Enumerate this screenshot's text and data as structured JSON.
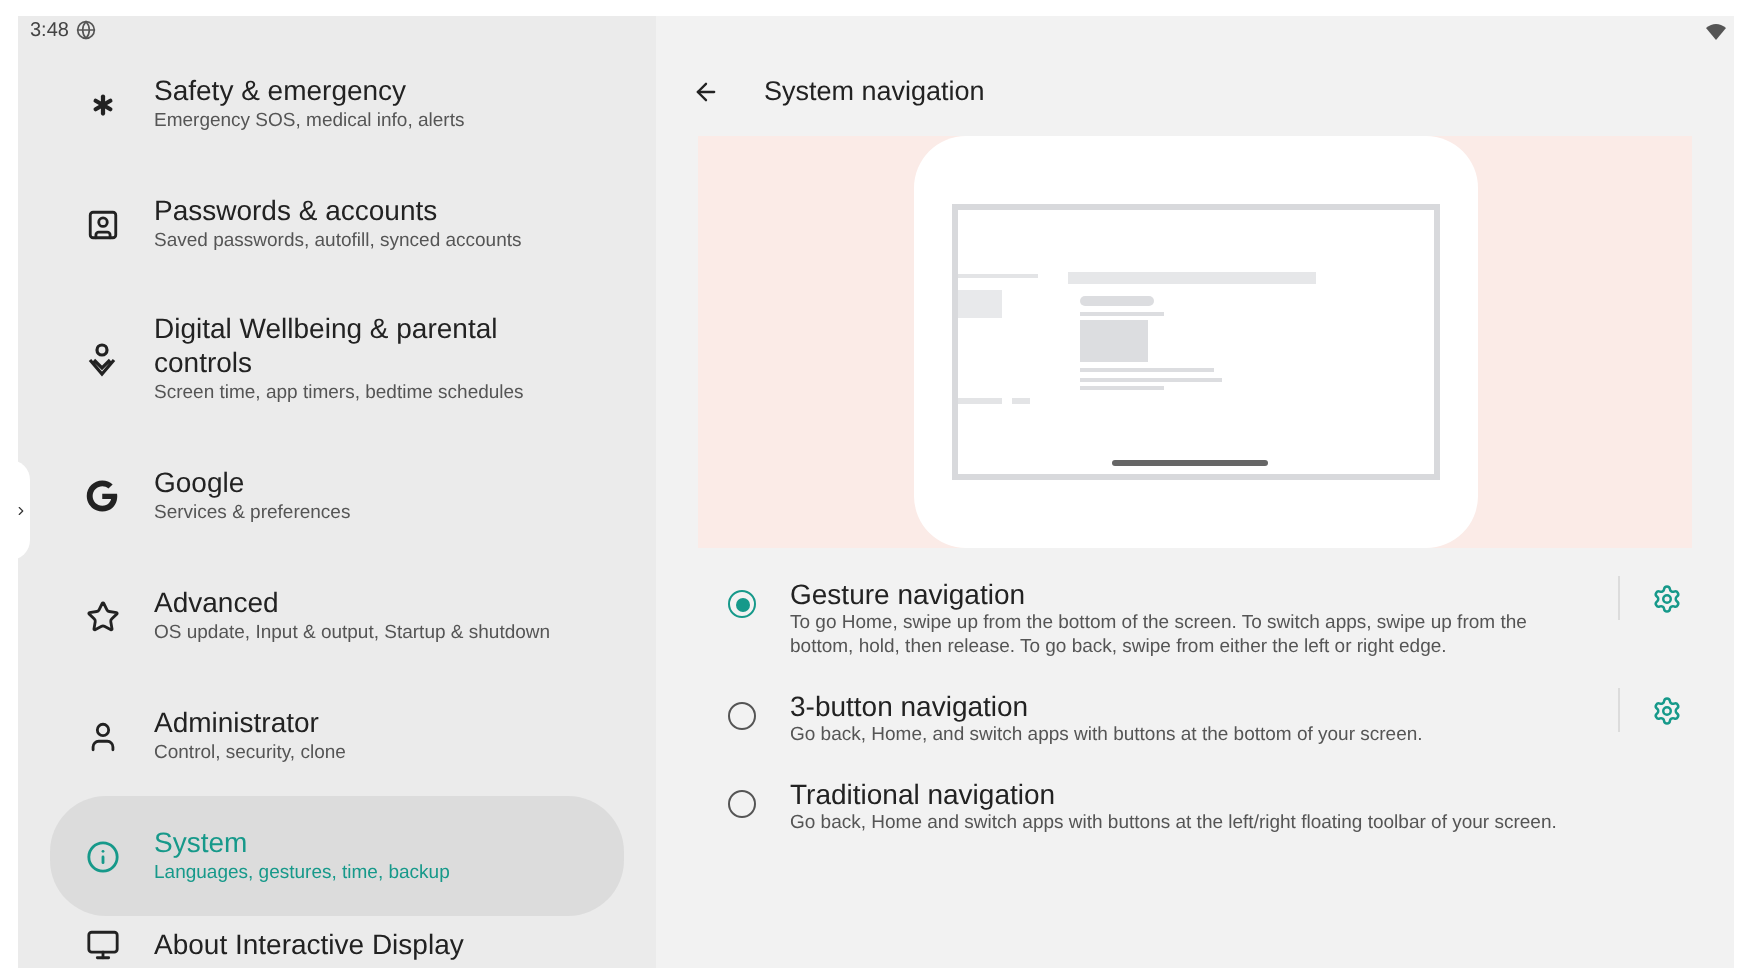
{
  "status_bar": {
    "time": "3:48"
  },
  "sidebar": {
    "items": [
      {
        "title": "Safety & emergency",
        "subtitle": "Emergency SOS, medical info, alerts",
        "selected": false
      },
      {
        "title": "Passwords & accounts",
        "subtitle": "Saved passwords, autofill, synced accounts",
        "selected": false
      },
      {
        "title": "Digital Wellbeing & parental controls",
        "subtitle": "Screen time, app timers, bedtime schedules",
        "selected": false
      },
      {
        "title": "Google",
        "subtitle": "Services & preferences",
        "selected": false
      },
      {
        "title": "Advanced",
        "subtitle": "OS update, Input & output, Startup & shutdown",
        "selected": false
      },
      {
        "title": "Administrator",
        "subtitle": "Control, security, clone",
        "selected": false
      },
      {
        "title": "System",
        "subtitle": "Languages, gestures, time, backup",
        "selected": true
      },
      {
        "title": "About Interactive Display",
        "selected": false
      }
    ]
  },
  "page": {
    "title": "System navigation",
    "options": [
      {
        "title": "Gesture navigation",
        "description": "To go Home, swipe up from the bottom of the screen. To switch apps, swipe up from the bottom, hold, then release. To go back, swipe from either the left or right edge.",
        "selected": true,
        "has_settings": true
      },
      {
        "title": "3-button navigation",
        "description": "Go back, Home, and switch apps with buttons at the bottom of your screen.",
        "selected": false,
        "has_settings": true
      },
      {
        "title": "Traditional navigation",
        "description": "Go back, Home and switch apps with buttons at the left/right floating toolbar of your screen.",
        "selected": false,
        "has_settings": false
      }
    ]
  }
}
